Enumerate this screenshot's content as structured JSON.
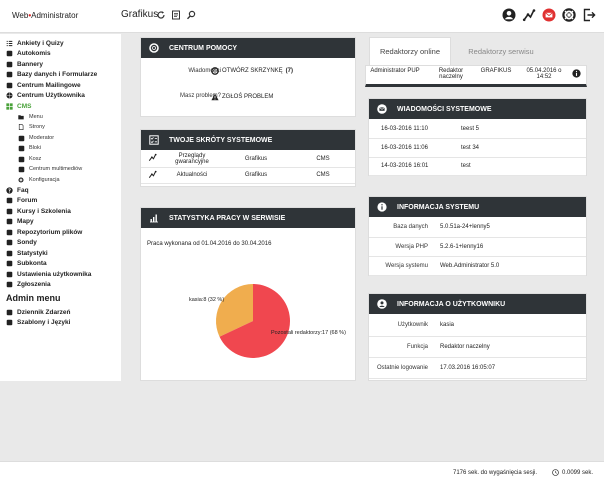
{
  "header": {
    "logo_left": "Web",
    "logo_dot": "•",
    "logo_right": "Administrator",
    "context_title": "Grafikus",
    "context_icons": [
      "refresh-icon",
      "notes-icon",
      "search-icon"
    ],
    "right_icons": [
      "user-icon",
      "network-icon",
      "mail-icon",
      "lifebuoy-icon",
      "logout-icon"
    ],
    "mail_badge_color": "#e03131"
  },
  "sidebar": {
    "items": [
      {
        "label": "Ankiety i Quizy",
        "icon": "list-icon"
      },
      {
        "label": "Autokomis",
        "icon": "car-icon"
      },
      {
        "label": "Bannery",
        "icon": "banner-icon"
      },
      {
        "label": "Bazy danych i Formularze",
        "icon": "database-icon"
      },
      {
        "label": "Centrum Mailingowe",
        "icon": "mail-icon"
      },
      {
        "label": "Centrum Użytkownika",
        "icon": "globe-icon"
      },
      {
        "label": "CMS",
        "icon": "grid-icon",
        "active": true
      }
    ],
    "cms_sub": [
      {
        "label": "Menu",
        "icon": "folder-icon"
      },
      {
        "label": "Strony",
        "icon": "page-icon"
      },
      {
        "label": "Moderator",
        "icon": "moderator-icon"
      },
      {
        "label": "Bloki",
        "icon": "blocks-icon"
      },
      {
        "label": "Kosz",
        "icon": "trash-icon"
      },
      {
        "label": "Centrum multimediów",
        "icon": "monitor-icon"
      },
      {
        "label": "Konfiguracja",
        "icon": "gear-icon"
      }
    ],
    "items_after": [
      {
        "label": "Faq",
        "icon": "question-icon"
      },
      {
        "label": "Forum",
        "icon": "forum-icon"
      },
      {
        "label": "Kursy i Szkolenia",
        "icon": "courses-icon"
      },
      {
        "label": "Mapy",
        "icon": "map-icon"
      },
      {
        "label": "Repozytorium plików",
        "icon": "repository-icon"
      },
      {
        "label": "Sondy",
        "icon": "poll-icon"
      },
      {
        "label": "Statystyki",
        "icon": "stats-icon"
      },
      {
        "label": "Subkonta",
        "icon": "accounts-icon"
      },
      {
        "label": "Ustawienia użytkownika",
        "icon": "settings-icon"
      },
      {
        "label": "Zgłoszenia",
        "icon": "tickets-icon"
      }
    ],
    "admin_menu_title": "Admin menu",
    "admin_items": [
      {
        "label": "Dziennik Zdarzeń",
        "icon": "log-icon"
      },
      {
        "label": "Szablony i Języki",
        "icon": "templates-icon"
      }
    ],
    "active_color": "#49a23a"
  },
  "help_panel": {
    "title": "CENTRUM POMOCY",
    "icon": "lifebuoy-icon",
    "rows": [
      {
        "label": "Wiadomości",
        "action": "OTWÓRZ SKRZYNKĘ",
        "badge": "7",
        "icon": "lifebuoy-icon"
      },
      {
        "label": "Masz problem?",
        "action": "ZGŁOŚ PROBLEM",
        "icon": "warning-icon"
      }
    ]
  },
  "shortcuts_panel": {
    "title": "TWOJE SKRÓTY SYSTEMOWE",
    "icon": "checklist-icon",
    "rows": [
      {
        "icon": "network-icon",
        "name": "Przeglądy gwarancyjne",
        "module": "Grafikus",
        "section": "CMS"
      },
      {
        "icon": "network-icon",
        "name": "Aktualności",
        "module": "Grafikus",
        "section": "CMS"
      }
    ]
  },
  "stats_panel": {
    "title": "STATYSTYKA PRACY W SERWISIE",
    "icon": "bar-chart-icon",
    "caption": "Praca wykonana od 01.04.2016 do 30.04.2016"
  },
  "chart_data": {
    "type": "pie",
    "slices": [
      {
        "label": "kasia",
        "value": 8,
        "percent": 32,
        "color": "#f0ad4e",
        "text": "kasia:8 (32 %)"
      },
      {
        "label": "Pozostali redaktorzy",
        "value": 17,
        "percent": 68,
        "color": "#f0474f",
        "text": "Pozostali redaktorzy:17 (68 %)"
      }
    ]
  },
  "tabs": {
    "items": [
      {
        "label": "Redaktorzy online",
        "active": true
      },
      {
        "label": "Redaktorzy serwisu",
        "active": false
      }
    ],
    "row": {
      "role": "Administrator PUP",
      "title": "Redaktor naczelny",
      "module": "GRAFIKUS",
      "date": "05.04.2016 o 14:52",
      "icon": "info-icon"
    }
  },
  "messages_panel": {
    "title": "WIADOMOŚCI SYSTEMOWE",
    "icon": "mail-icon",
    "rows": [
      {
        "date": "16-03-2016 11:10",
        "text": "teest 5"
      },
      {
        "date": "16-03-2016 11:06",
        "text": "test 34"
      },
      {
        "date": "14-03-2016 16:01",
        "text": "test"
      }
    ]
  },
  "system_panel": {
    "title": "INFORMACJA SYSTEMU",
    "icon": "info-icon",
    "rows": [
      {
        "key": "Baza danych",
        "value": "5.0.51a-24+lenny5"
      },
      {
        "key": "Wersja PHP",
        "value": "5.2.6-1+lenny16"
      },
      {
        "key": "Wersja systemu",
        "value": "Web.Administrator 5.0"
      }
    ]
  },
  "user_panel": {
    "title": "INFORMACJA O UŻYTKOWNIKU",
    "icon": "user-icon",
    "rows": [
      {
        "key": "Użytkownik",
        "value": "kasia"
      },
      {
        "key": "Funkcja",
        "value": "Redaktor naczelny"
      },
      {
        "key": "Ostatnie logowanie",
        "value": "17.03.2016 16:05:07"
      }
    ]
  },
  "footer": {
    "session": "7176 sek. do wygaśnięcia sesji.",
    "timer": "0.0099 sek.",
    "timer_icon": "clock-icon"
  }
}
